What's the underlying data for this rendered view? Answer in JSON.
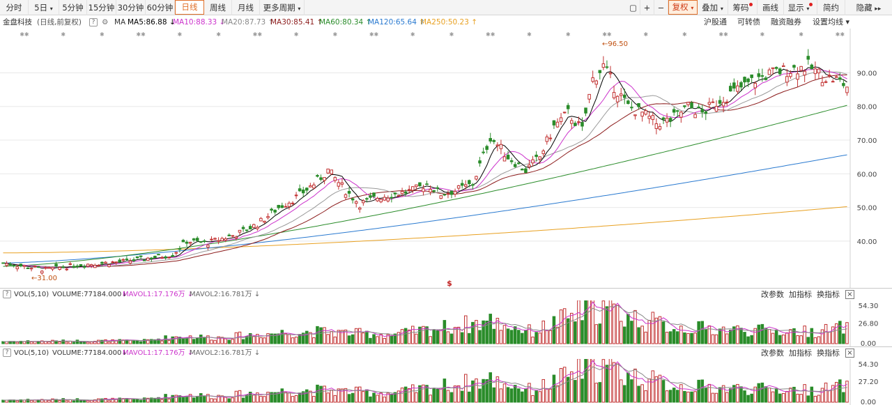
{
  "toolbar": {
    "periods": [
      "分时",
      "5日",
      "5分钟",
      "15分钟",
      "30分钟",
      "60分钟",
      "日线",
      "周线",
      "月线",
      "更多周期"
    ],
    "active_period": "日线",
    "right": [
      "复权",
      "叠加",
      "筹码",
      "画线",
      "显示",
      "简约",
      "隐藏"
    ],
    "icons": [
      "box-icon",
      "plus-icon",
      "minus-icon"
    ]
  },
  "info": {
    "stock": "金盘科技",
    "mode": "(日线,前复权)",
    "ma_label": "MA",
    "ma5": "MA5:86.88",
    "ma10": "MA10:88.33",
    "ma20": "MA20:87.73",
    "ma30": "MA30:85.41",
    "ma60": "MA60:80.34",
    "ma120": "MA120:65.64",
    "ma250": "MA250:50.23",
    "links": [
      "沪股通",
      "可转债",
      "融资融券",
      "设置均线"
    ]
  },
  "colors": {
    "up": "#c23131",
    "down": "#2a8c2a",
    "ma5": "#000000",
    "ma10": "#cc33cc",
    "ma20": "#999999",
    "ma30": "#8b1a1a",
    "ma60": "#2a8c2a",
    "ma120": "#2a7ad0",
    "ma250": "#e8a020"
  },
  "annotations": {
    "high": "96.50",
    "low": "31.00",
    "marker": "$"
  },
  "volume_panels": [
    {
      "label": "VOL(5,10)",
      "volume": "VOLUME:77184.000",
      "mavol1": "MAVOL1:17.176万",
      "mavol2": "MAVOL2:16.781万",
      "links": [
        "改参数",
        "加指标",
        "换指标"
      ],
      "ticks": [
        "54.30",
        "26.80",
        "0.00"
      ]
    },
    {
      "label": "VOL(5,10)",
      "volume": "VOLUME:77184.000",
      "mavol1": "MAVOL1:17.176万",
      "mavol2": "MAVOL2:16.781万",
      "links": [
        "改参数",
        "加指标",
        "换指标"
      ],
      "ticks": [
        "54.30",
        "27.20",
        "0.00"
      ]
    }
  ],
  "chart_data": {
    "type": "candlestick",
    "title": "",
    "y_ticks": [
      40,
      50,
      60,
      70,
      80,
      90
    ],
    "ylim": [
      29,
      99
    ],
    "grid": true,
    "notes": "Daily candles (forward-adjusted) with MA5/10/20/30/60/120/250 overlays; volume in units of 万 shown in two lower panels (ticks 54.30/26.80/0.00 and 54.30/27.20/0.00).",
    "anchors": [
      [
        0,
        33.5
      ],
      [
        12,
        31.5
      ],
      [
        22,
        33
      ],
      [
        35,
        34
      ],
      [
        48,
        36
      ],
      [
        52,
        40
      ],
      [
        58,
        39.5
      ],
      [
        66,
        42
      ],
      [
        72,
        45
      ],
      [
        78,
        50
      ],
      [
        83,
        53
      ],
      [
        88,
        57
      ],
      [
        92,
        61
      ],
      [
        97,
        55
      ],
      [
        101,
        51
      ],
      [
        106,
        53
      ],
      [
        111,
        54
      ],
      [
        116,
        55
      ],
      [
        120,
        57
      ],
      [
        124,
        54
      ],
      [
        128,
        55
      ],
      [
        133,
        57
      ],
      [
        138,
        71
      ],
      [
        143,
        65
      ],
      [
        148,
        61
      ],
      [
        152,
        65
      ],
      [
        156,
        74
      ],
      [
        160,
        78
      ],
      [
        164,
        73
      ],
      [
        167,
        88
      ],
      [
        170,
        92
      ],
      [
        173,
        86
      ],
      [
        177,
        80
      ],
      [
        181,
        78
      ],
      [
        185,
        75
      ],
      [
        189,
        76
      ],
      [
        194,
        80
      ],
      [
        198,
        78
      ],
      [
        203,
        82
      ],
      [
        208,
        85
      ],
      [
        213,
        88
      ],
      [
        218,
        90
      ],
      [
        223,
        91
      ],
      [
        228,
        92
      ],
      [
        232,
        89
      ],
      [
        236,
        88
      ],
      [
        239,
        86
      ]
    ],
    "volume_anchors": [
      [
        0,
        3
      ],
      [
        40,
        4
      ],
      [
        50,
        10
      ],
      [
        60,
        8
      ],
      [
        80,
        15
      ],
      [
        90,
        16
      ],
      [
        110,
        12
      ],
      [
        138,
        30
      ],
      [
        150,
        16
      ],
      [
        160,
        35
      ],
      [
        168,
        50
      ],
      [
        178,
        35
      ],
      [
        190,
        22
      ],
      [
        210,
        18
      ],
      [
        230,
        16
      ],
      [
        239,
        22
      ]
    ],
    "ma_end": {
      "MA5": 86.88,
      "MA10": 88.33,
      "MA20": 87.73,
      "MA30": 85.41,
      "MA60": 80.34,
      "MA120": 65.64,
      "MA250": 50.23
    }
  }
}
